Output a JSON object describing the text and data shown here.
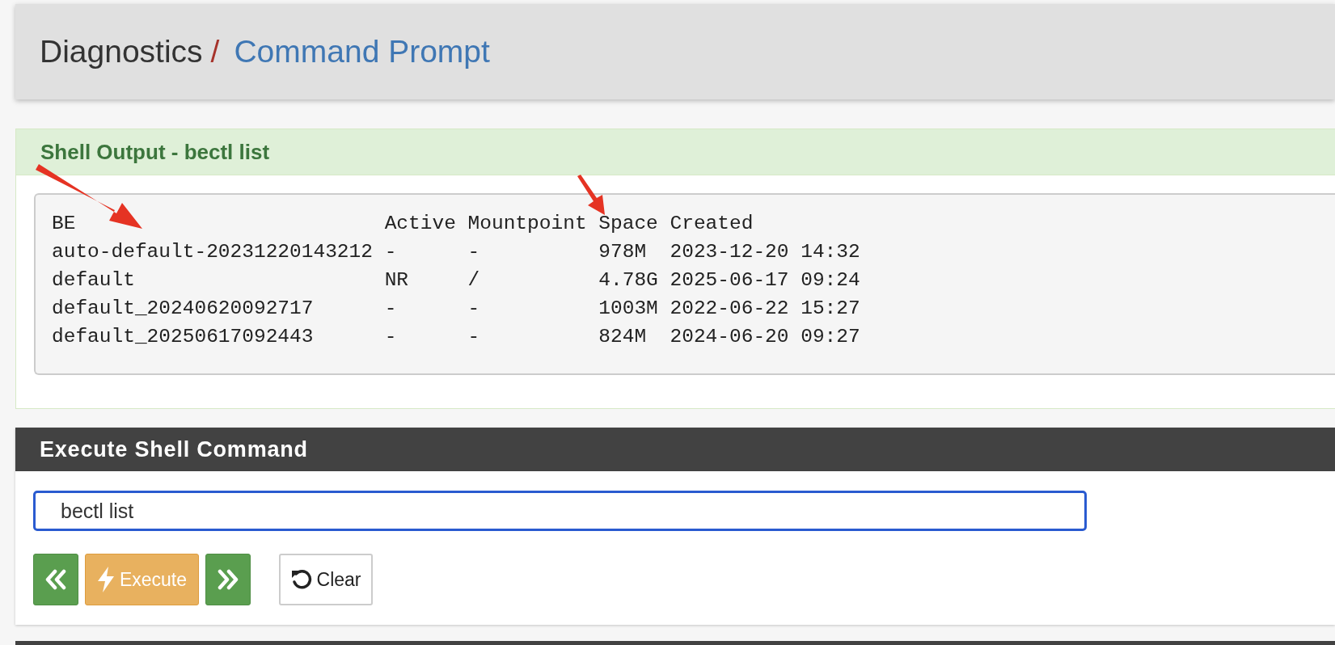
{
  "breadcrumb": {
    "section": "Diagnostics",
    "separator": "/",
    "page": "Command Prompt"
  },
  "output_panel": {
    "title": "Shell Output - bectl list",
    "columns": [
      "BE",
      "Active",
      "Mountpoint",
      "Space",
      "Created"
    ],
    "rows": [
      [
        "auto-default-20231220143212",
        "-",
        "-",
        "978M",
        "2023-12-20 14:32"
      ],
      [
        "default",
        "NR",
        "/",
        "4.78G",
        "2025-06-17 09:24"
      ],
      [
        "default_20240620092717",
        "-",
        "-",
        "1003M",
        "2022-06-22 15:27"
      ],
      [
        "default_20250617092443",
        "-",
        "-",
        "824M",
        "2024-06-20 09:27"
      ]
    ]
  },
  "command_panel": {
    "title": "Execute Shell Command",
    "command": {
      "value": "bectl list",
      "focused": true
    },
    "buttons": [
      {
        "kind": "previous"
      },
      {
        "kind": "execute",
        "label": "Execute"
      },
      {
        "kind": "next"
      },
      {
        "kind": "clear",
        "label": "Clear"
      }
    ]
  }
}
